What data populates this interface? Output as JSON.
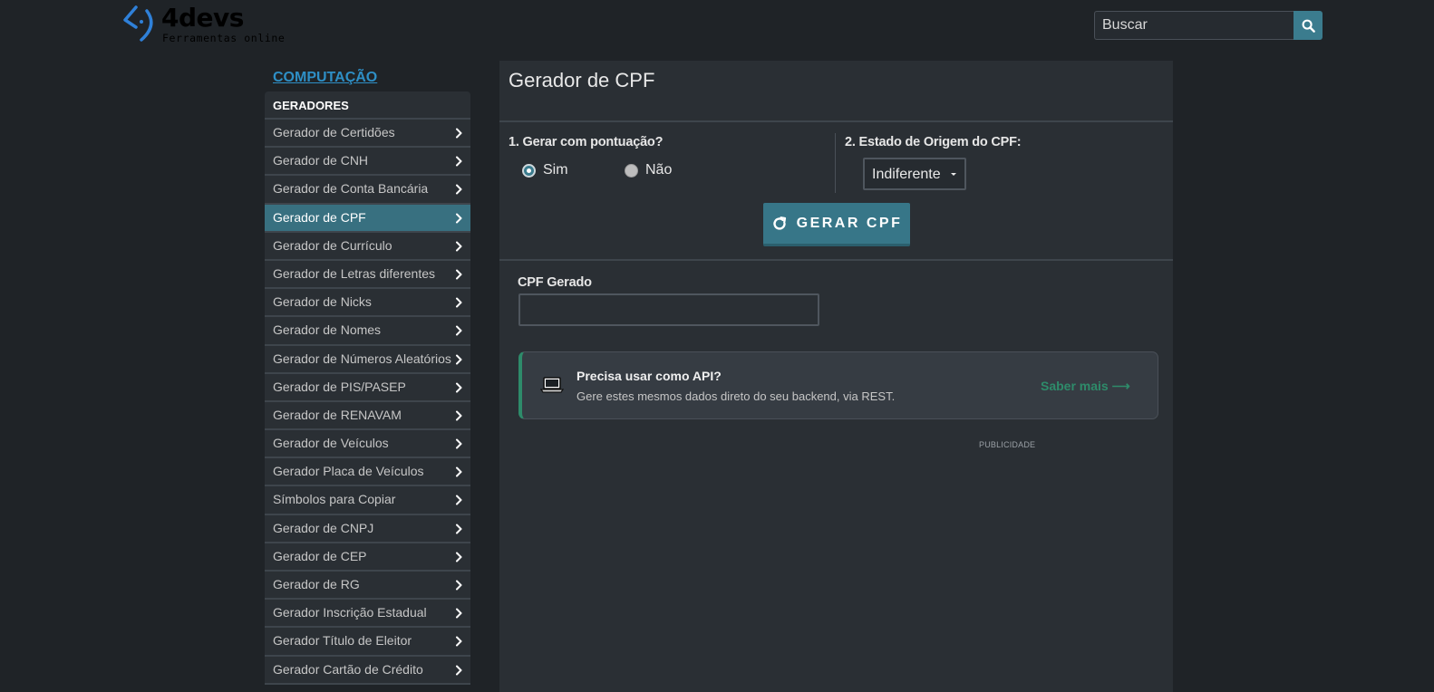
{
  "header": {
    "logo_name": "4devs",
    "logo_tagline": "Ferramentas online",
    "search": {
      "placeholder": "Buscar",
      "value": ""
    }
  },
  "sidebar": {
    "category_link": "COMPUTAÇÃO",
    "group_title": "GERADORES",
    "items": [
      {
        "label": "Gerador de Certidões",
        "active": false
      },
      {
        "label": "Gerador de CNH",
        "active": false
      },
      {
        "label": "Gerador de Conta Bancária",
        "active": false
      },
      {
        "label": "Gerador de CPF",
        "active": true
      },
      {
        "label": "Gerador de Currículo",
        "active": false
      },
      {
        "label": "Gerador de Letras diferentes",
        "active": false
      },
      {
        "label": "Gerador de Nicks",
        "active": false
      },
      {
        "label": "Gerador de Nomes",
        "active": false
      },
      {
        "label": "Gerador de Números Aleatórios",
        "active": false
      },
      {
        "label": "Gerador de PIS/PASEP",
        "active": false
      },
      {
        "label": "Gerador de RENAVAM",
        "active": false
      },
      {
        "label": "Gerador de Veículos",
        "active": false
      },
      {
        "label": "Gerador Placa de Veículos",
        "active": false
      },
      {
        "label": "Símbolos para Copiar",
        "active": false
      },
      {
        "label": "Gerador de CNPJ",
        "active": false
      },
      {
        "label": "Gerador de CEP",
        "active": false
      },
      {
        "label": "Gerador de RG",
        "active": false
      },
      {
        "label": "Gerador Inscrição Estadual",
        "active": false
      },
      {
        "label": "Gerador Título de Eleitor",
        "active": false
      },
      {
        "label": "Gerador Cartão de Crédito",
        "active": false
      }
    ]
  },
  "main": {
    "title": "Gerador de CPF",
    "option1": {
      "label": "1. Gerar com pontuação?",
      "choices": [
        {
          "label": "Sim",
          "selected": true
        },
        {
          "label": "Não",
          "selected": false
        }
      ]
    },
    "option2": {
      "label": "2. Estado de Origem do CPF:",
      "selected": "Indiferente"
    },
    "generate_button": "GERAR CPF",
    "output": {
      "label": "CPF Gerado",
      "value": ""
    },
    "api_card": {
      "title": "Precisa usar como API?",
      "description": "Gere estes mesmos dados direto do seu backend, via REST.",
      "link": "Saber mais ⟶"
    },
    "ad_label": "PUBLICIDADE"
  },
  "colors": {
    "background": "#1f2327",
    "panel": "#2a2f34",
    "accent": "#387080",
    "link": "#2e8fc6",
    "api_green": "#2e8b6a"
  }
}
